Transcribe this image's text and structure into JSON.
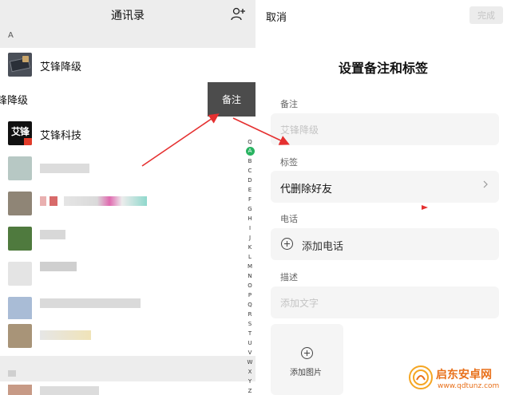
{
  "left": {
    "title": "通讯录",
    "section_a": "A",
    "contact1_name": "艾锋降级",
    "swipe_name": "锋降级",
    "remark_button": "备注",
    "contact2_name": "艾锋科技",
    "contact2_avatar_text": "艾锋",
    "index": [
      "Q",
      "A",
      "B",
      "C",
      "D",
      "E",
      "F",
      "G",
      "H",
      "I",
      "J",
      "K",
      "L",
      "M",
      "N",
      "O",
      "P",
      "Q",
      "R",
      "S",
      "T",
      "U",
      "V",
      "W",
      "X",
      "Y",
      "Z",
      "#"
    ]
  },
  "right": {
    "cancel": "取消",
    "done": "完成",
    "title": "设置备注和标签",
    "remark_label": "备注",
    "remark_placeholder": "艾锋降级",
    "tag_label": "标签",
    "tag_value": "代删除好友",
    "phone_label": "电话",
    "phone_add": "添加电话",
    "desc_label": "描述",
    "desc_placeholder": "添加文字",
    "add_image": "添加图片"
  },
  "colors": {
    "accent_green": "#29b361",
    "arrow_red": "#e53030"
  },
  "watermark": {
    "title": "启东安卓网",
    "url": "www.qdtunz.com"
  }
}
